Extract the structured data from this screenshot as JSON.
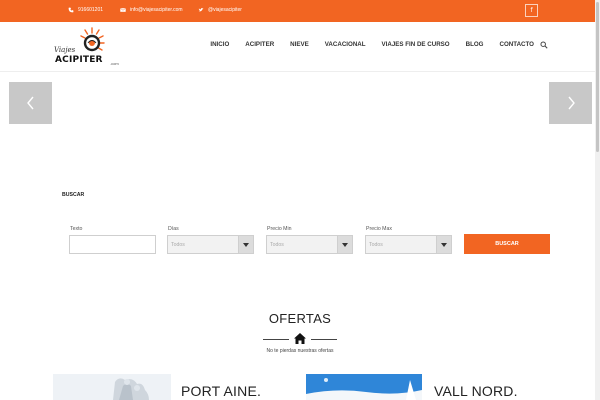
{
  "topbar": {
    "phone": "916601201",
    "email": "info@viajesacipiter.com",
    "twitter": "@viajesacipiter",
    "facebook_glyph": "f",
    "bg_color": "#f26522"
  },
  "logo": {
    "line1": "Viajes",
    "line2": "ACIPITER",
    "line3": ".com"
  },
  "nav": {
    "items": [
      "INICIO",
      "ACIPITER",
      "NIEVE",
      "VACACIONAL",
      "VIAJES FIN DE CURSO",
      "BLOG",
      "CONTACTO"
    ]
  },
  "search": {
    "title": "BUSCAR",
    "texto_label": "Texto",
    "texto_value": "",
    "dias_label": "Días",
    "dias_value": "Todos",
    "precio_min_label": "Precio Min",
    "precio_min_value": "Todos",
    "precio_max_label": "Precio Max",
    "precio_max_value": "Todos",
    "button_label": "BUSCAR"
  },
  "ofertas": {
    "title": "OFERTAS",
    "subtitle": "No te pierdas nuestras ofertas",
    "items": [
      {
        "title": "PORT AINE."
      },
      {
        "title": "VALL NORD."
      }
    ]
  },
  "colors": {
    "accent": "#f26522"
  }
}
